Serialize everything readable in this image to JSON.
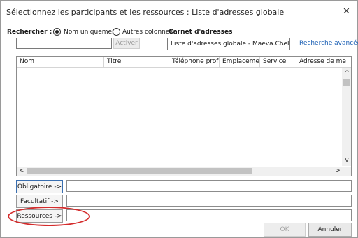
{
  "dialog": {
    "title": "Sélectionnez les participants et les ressources : Liste d'adresses globale",
    "close_glyph": "✕"
  },
  "search": {
    "label": "Rechercher :",
    "option_name_only": "Nom uniquement",
    "option_other_columns": "Autres colonnes",
    "selected_option": "Nom uniquement",
    "input_value": "",
    "activate_label": "Activer"
  },
  "address_book": {
    "label": "Carnet d'adresses",
    "selected_value": "Liste d'adresses globale - Maeva.Chelly@mi",
    "advanced_search_label": "Recherche avancée"
  },
  "list": {
    "columns": [
      "Nom",
      "Titre",
      "Téléphone profe…",
      "Emplacement",
      "Service",
      "Adresse de me"
    ],
    "rows": [],
    "scroll_up": "^",
    "scroll_down": "v",
    "scroll_left": "<",
    "scroll_right": ">"
  },
  "recipients": {
    "required_label": "Obligatoire ->",
    "optional_label": "Facultatif ->",
    "resources_label": "Ressources ->",
    "required_value": "",
    "optional_value": "",
    "resources_value": ""
  },
  "footer": {
    "ok_label": "OK",
    "cancel_label": "Annuler"
  },
  "colors": {
    "highlight_ellipse": "#d42b2b",
    "link": "#1a5fb4"
  }
}
